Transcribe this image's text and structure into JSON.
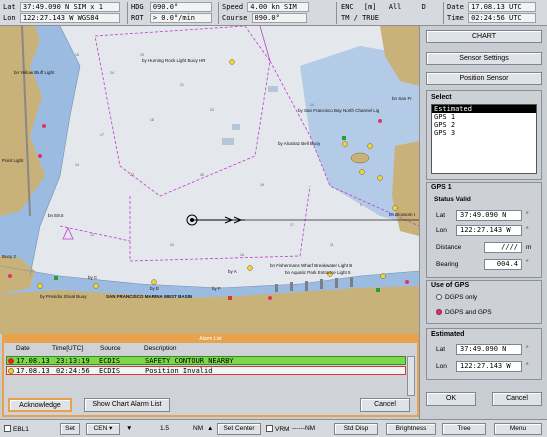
{
  "topbar": {
    "lat_label": "Lat",
    "lat_value": "37:49.090 N SIM x 1",
    "lon_label": "Lon",
    "lon_value": "122:27.143 W WGS84",
    "hdg_label": "HDG",
    "hdg_value": "090.0°",
    "rot_label": "ROT",
    "rot_value": "> 0.0°/min",
    "speed_label": "Speed",
    "speed_value": "4.00 kn SIM",
    "course_label": "Course",
    "course_value": "090.0°",
    "enc_label": "ENC",
    "enc_unit": "[m]",
    "enc_value": "All",
    "enc_mode": "D",
    "tm_label": "TM / TRUE",
    "date_label": "Date",
    "date_value": "17.08.13 UTC",
    "time_label": "Time",
    "time_value": "02:24:56 UTC"
  },
  "chart": {
    "labels": [
      "bn Yellow Bluff Light",
      "by Hurning Rock Light Buoy HR",
      "by San Francisco Bay North Channel Lig",
      "bn San Fr",
      "by Alcatraz Bell Buoy",
      "bn Blossom I",
      "Point Light",
      "bn E8.5",
      "bn Fishermans Wharf Breakwater Light B",
      "bn Aquatic Park Entrance Light 5",
      "by A",
      "by C",
      "by E",
      "by F",
      "by Presidio Shoal Buoy",
      "SAN FRANCISCO MARINA WEST BASIN",
      "Buoy 2"
    ]
  },
  "panel": {
    "chart_button": "CHART",
    "sensor_settings_button": "Sensor Settings",
    "position_sensor_button": "Position Sensor",
    "select_label": "Select",
    "select_items": [
      "Estimated",
      "GPS 1",
      "GPS 2",
      "GPS 3"
    ],
    "gps1_label": "GPS 1",
    "status_label": "Status Valid",
    "lat_label": "Lat",
    "lat_value": "37:49.090 N",
    "lon_label": "Lon",
    "lon_value": "122:27.143 W",
    "distance_label": "Distance",
    "distance_value": "////",
    "distance_unit": "m",
    "bearing_label": "Bearing",
    "bearing_value": "004.4",
    "deg": "°",
    "use_gps_label": "Use of GPS",
    "dgps_only": "DGPS only",
    "dgps_and_gps": "DGPS and GPS",
    "estimated_label": "Estimated",
    "est_lat_value": "37:49.090 N",
    "est_lon_value": "122:27.143 W",
    "ok_button": "OK",
    "cancel_button": "Cancel"
  },
  "alarm": {
    "title": "Alarm List",
    "col_date": "Date",
    "col_time": "Time[UTC]",
    "col_source": "Source",
    "col_description": "Description",
    "rows": [
      {
        "date": "17.08.13",
        "time": "23:13:19",
        "source": "ECDIS",
        "description": "SAFETY CONTOUR NEARBY"
      },
      {
        "date": "17.08.13",
        "time": "02:24:56",
        "source": "ECDIS",
        "description": "Position Invalid"
      }
    ],
    "acknowledge_button": "Acknowledge",
    "show_list_button": "Show Chart Alarm List",
    "cancel_button": "Cancel"
  },
  "bottombar": {
    "ebl": "EBL1",
    "set1": "Set",
    "cen": "CEN",
    "range": "1.5",
    "nm": "NM",
    "set_center": "Set Center",
    "vrm": "VRM",
    "vrm_value": "------NM",
    "std_disp": "Std Disp",
    "brightness": "Brightness",
    "tree": "Tree",
    "menu": "Menu"
  },
  "colors": {
    "alarm_accent": "#e9a24c",
    "alarm_active_row": "#7bd84a",
    "land": "#c9b27a",
    "shallow": "#9bbbe0",
    "deep": "#e4e7ec",
    "selection": "#e0336c"
  }
}
